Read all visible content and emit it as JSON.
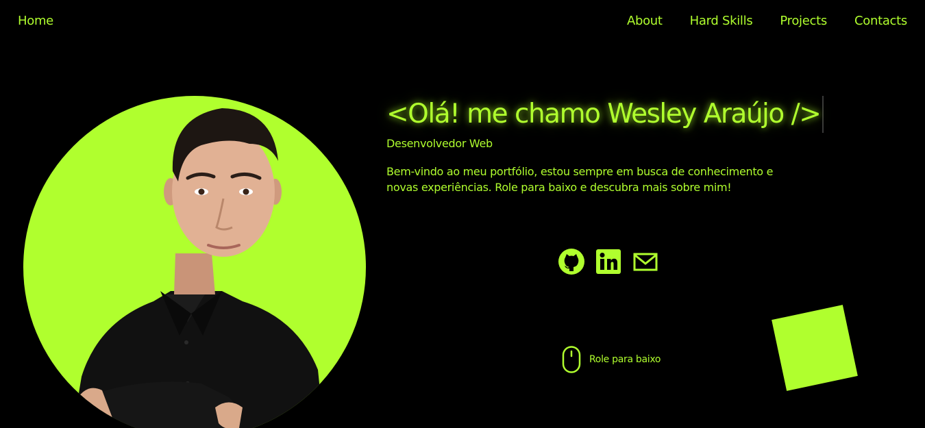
{
  "nav": {
    "home_label": "Home",
    "links": [
      {
        "label": "About"
      },
      {
        "label": "Hard Skills"
      },
      {
        "label": "Projects"
      },
      {
        "label": "Contacts"
      }
    ]
  },
  "hero": {
    "title": "<Olá! me chamo Wesley Araújo />",
    "subtitle": "Desenvolvedor Web",
    "description": "Bem-vindo ao meu portfólio, estou sempre em busca de conhecimento e novas experiências. Role para baixo e descubra mais sobre mim!"
  },
  "social": {
    "icons": [
      "github-icon",
      "linkedin-icon",
      "mail-icon"
    ]
  },
  "scroll_hint": {
    "label": "Role para baixo",
    "icon": "mouse-icon"
  },
  "colors": {
    "background": "#000000",
    "accent": "#b0ff2e"
  }
}
